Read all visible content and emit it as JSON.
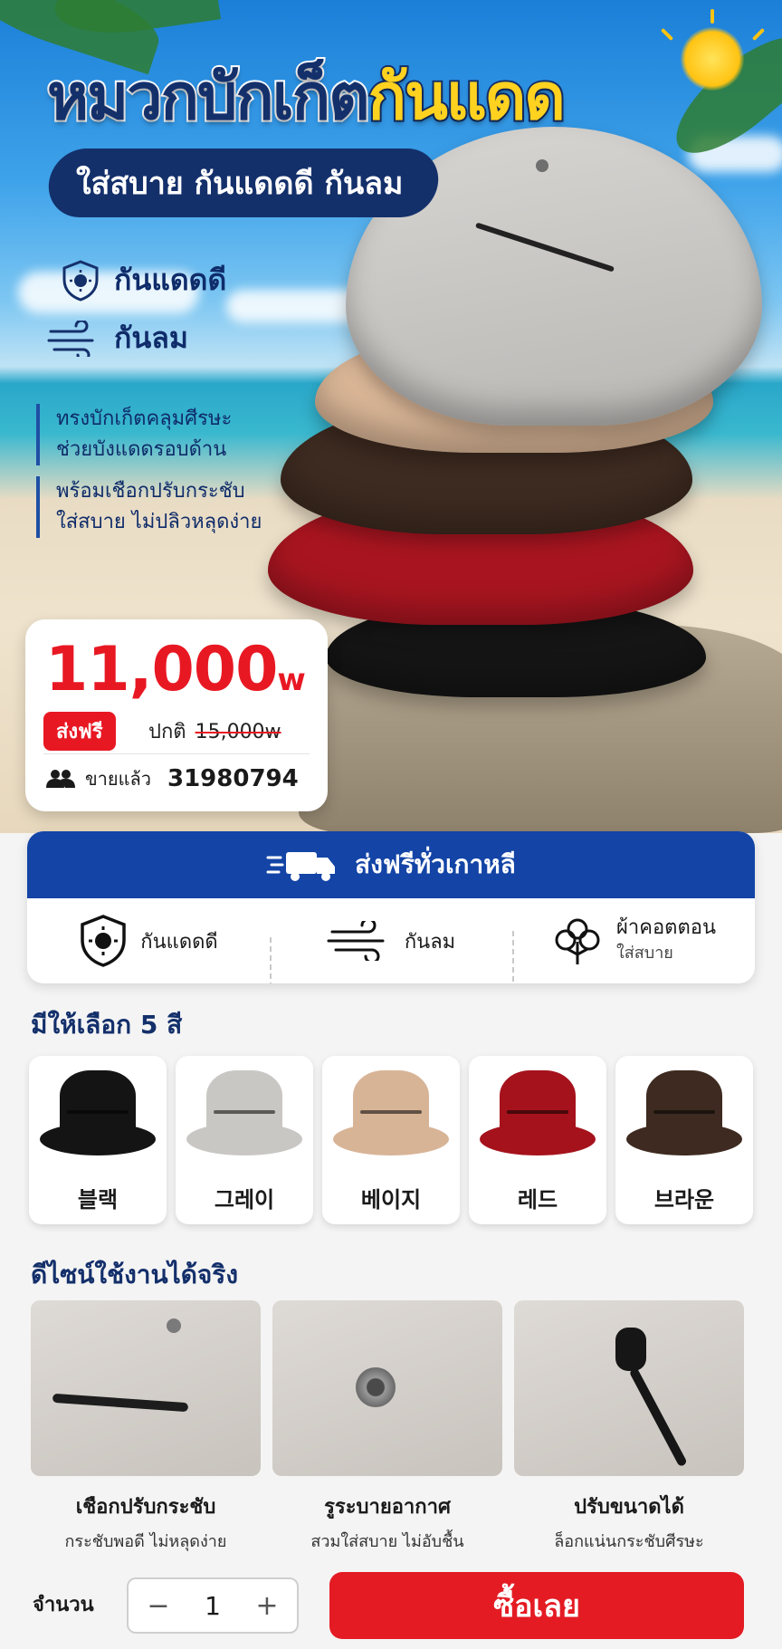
{
  "hero": {
    "title_part1": "หมวกบักเก็ต",
    "title_part2": "กันแดด",
    "subtitle": "ใส่สบาย กันแดดดี กันลม",
    "features": [
      "กันแดดดี",
      "กันลม"
    ],
    "bullets": [
      [
        "ทรงบักเก็ตคลุมศีรษะ",
        "ช่วยบังแดดรอบด้าน"
      ],
      [
        "พร้อมเชือกปรับกระชับ",
        "ใส่สบาย ไม่ปลิวหลุดง่าย"
      ]
    ]
  },
  "price": {
    "amount": "11,000",
    "currency": "w",
    "free_shipping": "ส่งฟรี",
    "regular_label": "ปกติ",
    "regular_price": "15,000w",
    "sold_label": "ขายแล้ว",
    "sold_count": "31980794"
  },
  "shipping": {
    "title": "ส่งฟรีทั่วเกาหลี",
    "items": [
      {
        "label": "กันแดดดี",
        "sub": ""
      },
      {
        "label": "กันลม",
        "sub": ""
      },
      {
        "label": "ผ้าคอตตอน",
        "sub": "ใส่สบาย"
      }
    ]
  },
  "colors": {
    "title": "มีให้เลือก 5 สี",
    "options": [
      {
        "name": "블랙",
        "hex": "#141414"
      },
      {
        "name": "그레이",
        "hex": "#c9c7c4"
      },
      {
        "name": "베이지",
        "hex": "#d8b497"
      },
      {
        "name": "레드",
        "hex": "#a5121c"
      },
      {
        "name": "브라운",
        "hex": "#3e2a20"
      }
    ]
  },
  "design": {
    "title": "ดีไซน์ใช้งานได้จริง",
    "items": [
      {
        "title": "เชือกปรับกระชับ",
        "sub": "กระชับพอดี ไม่หลุดง่าย"
      },
      {
        "title": "รูระบายอากาศ",
        "sub": "สวมใส่สบาย ไม่อับชื้น"
      },
      {
        "title": "ปรับขนาดได้",
        "sub": "ล็อกแน่นกระชับศีรษะ"
      }
    ]
  },
  "purchase": {
    "qty_label": "จำนวน",
    "qty_value": "1",
    "minus": "−",
    "plus": "+",
    "buy_label": "ซื้อเลย"
  }
}
